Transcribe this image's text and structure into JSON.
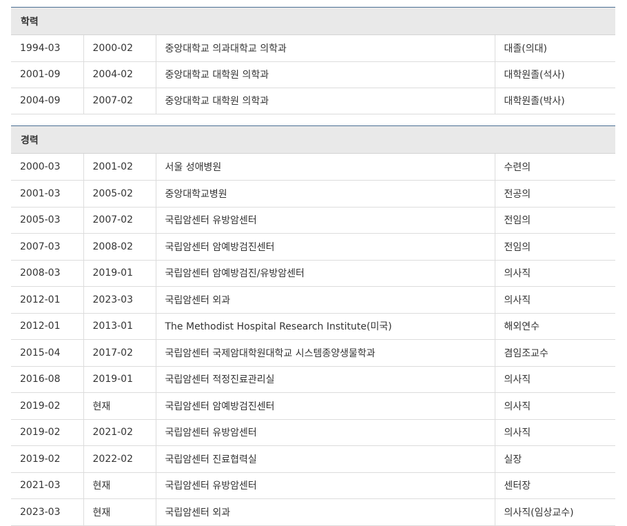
{
  "education": {
    "heading": "학력",
    "rows": [
      {
        "start": "1994-03",
        "end": "2000-02",
        "org": "중앙대학교 의과대학교 의학과",
        "title": "대졸(의대)"
      },
      {
        "start": "2001-09",
        "end": "2004-02",
        "org": "중앙대학교 대학원 의학과",
        "title": "대학원졸(석사)"
      },
      {
        "start": "2004-09",
        "end": "2007-02",
        "org": "중앙대학교 대학원 의학과",
        "title": "대학원졸(박사)"
      }
    ]
  },
  "career": {
    "heading": "경력",
    "rows": [
      {
        "start": "2000-03",
        "end": "2001-02",
        "org": "서울 성애병원",
        "title": "수련의"
      },
      {
        "start": "2001-03",
        "end": "2005-02",
        "org": "중앙대학교병원",
        "title": "전공의"
      },
      {
        "start": "2005-03",
        "end": "2007-02",
        "org": "국립암센터 유방암센터",
        "title": "전임의"
      },
      {
        "start": "2007-03",
        "end": "2008-02",
        "org": "국립암센터 암예방검진센터",
        "title": "전임의"
      },
      {
        "start": "2008-03",
        "end": "2019-01",
        "org": "국립암센터 암예방검진/유방암센터",
        "title": "의사직"
      },
      {
        "start": "2012-01",
        "end": "2023-03",
        "org": "국립암센터 외과",
        "title": "의사직"
      },
      {
        "start": "2012-01",
        "end": "2013-01",
        "org": "The Methodist Hospital Research Institute(미국)",
        "title": "해외연수"
      },
      {
        "start": "2015-04",
        "end": "2017-02",
        "org": "국립암센터 국제암대학원대학교 시스템종양생물학과",
        "title": "겸임조교수"
      },
      {
        "start": "2016-08",
        "end": "2019-01",
        "org": "국립암센터 적정진료관리실",
        "title": "의사직"
      },
      {
        "start": "2019-02",
        "end": "현재",
        "org": "국립암센터 암예방검진센터",
        "title": "의사직"
      },
      {
        "start": "2019-02",
        "end": "2021-02",
        "org": "국립암센터 유방암센터",
        "title": "의사직"
      },
      {
        "start": "2019-02",
        "end": "2022-02",
        "org": "국립암센터 진료협력실",
        "title": "실장"
      },
      {
        "start": "2021-03",
        "end": "현재",
        "org": "국립암센터 유방암센터",
        "title": "센터장"
      },
      {
        "start": "2023-03",
        "end": "현재",
        "org": "국립암센터 외과",
        "title": "의사직(임상교수)"
      }
    ]
  }
}
